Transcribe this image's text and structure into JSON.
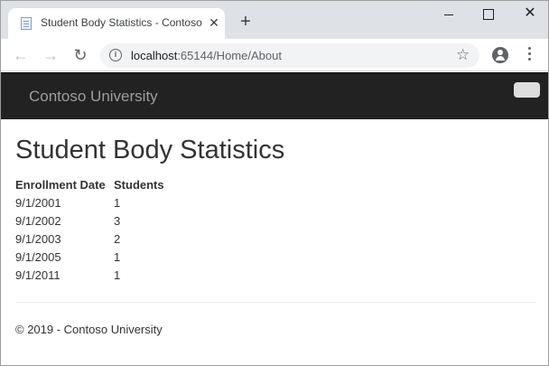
{
  "browser": {
    "tab_title": "Student Body Statistics - Contoso",
    "tab_close": "✕",
    "new_tab": "+",
    "url_host": "localhost",
    "url_rest": ":65144/Home/About",
    "window_close": "✕"
  },
  "navbar": {
    "brand": "Contoso University"
  },
  "main": {
    "title": "Student Body Statistics",
    "table": {
      "headers": [
        "Enrollment Date",
        "Students"
      ],
      "rows": [
        [
          "9/1/2001",
          "1"
        ],
        [
          "9/1/2002",
          "3"
        ],
        [
          "9/1/2003",
          "2"
        ],
        [
          "9/1/2005",
          "1"
        ],
        [
          "9/1/2011",
          "1"
        ]
      ]
    }
  },
  "footer": {
    "text": "© 2019 - Contoso University"
  },
  "colors": {
    "navbar_bg": "#222222",
    "brand_text": "#9d9d9d",
    "tabstrip_bg": "#dee1e6"
  }
}
